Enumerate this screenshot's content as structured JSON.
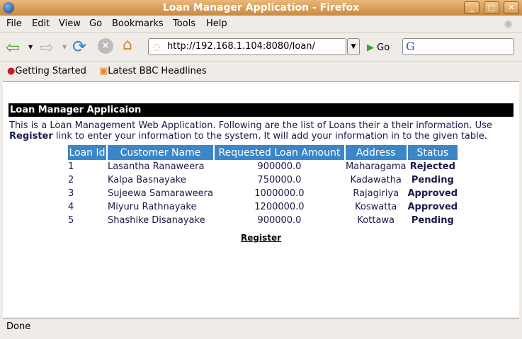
{
  "window": {
    "title": "Loan Manager Application - Firefox"
  },
  "menu": [
    "File",
    "Edit",
    "View",
    "Go",
    "Bookmarks",
    "Tools",
    "Help"
  ],
  "navbar": {
    "url": "http://192.168.1.104:8080/loan/",
    "go_label": "Go",
    "search_value": ""
  },
  "bookmarks": [
    "Getting Started",
    "Latest BBC Headlines"
  ],
  "page": {
    "heading": "Loan Manager Applicaion",
    "intro_1": "This is a Loan Management Web Application. Following are the list of Loans their a their information. Use",
    "intro_register": "Register",
    "intro_2": " link to enter your information to the system. It will add your information in to the given table.",
    "columns": [
      "Loan Id",
      "Customer Name",
      "Requested Loan Amount",
      "Address",
      "Status"
    ],
    "rows": [
      [
        "1",
        "Lasantha Ranaweera",
        "900000.0",
        "Maharagama",
        "Rejected"
      ],
      [
        "2",
        "Kalpa Basnayake",
        "750000.0",
        "Kadawatha",
        "Pending"
      ],
      [
        "3",
        "Sujeewa Samaraweera",
        "1000000.0",
        "Rajagiriya",
        "Approved"
      ],
      [
        "4",
        "Miyuru Rathnayake",
        "1200000.0",
        "Koswatta",
        "Approved"
      ],
      [
        "5",
        "Shashike Disanayake",
        "900000.0",
        "Kottawa",
        "Pending"
      ]
    ],
    "register_link": "Register"
  },
  "status": "Done",
  "colors": {
    "header_bg": "#3a86c8",
    "text": "#1a1a4a",
    "titlebar": "#d39b52"
  }
}
